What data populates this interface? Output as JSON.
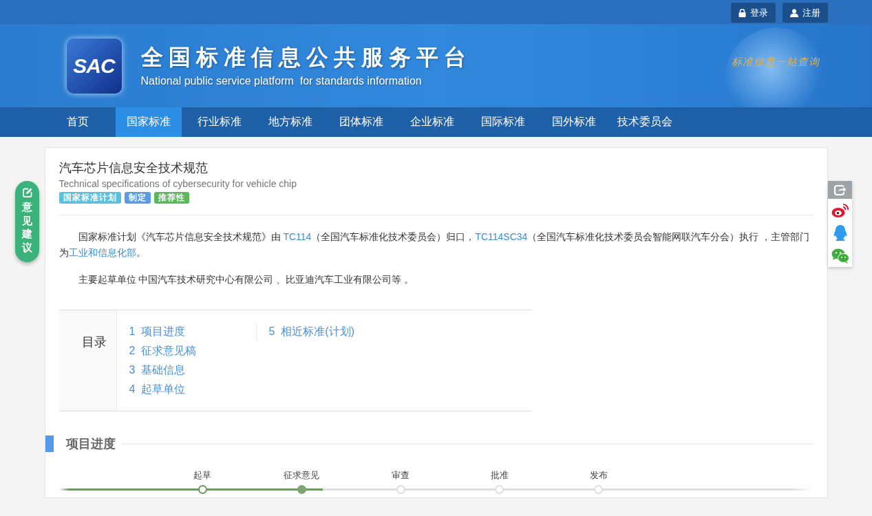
{
  "top_bar": {
    "buttons": [
      {
        "kind": "login",
        "label": "登录"
      },
      {
        "kind": "register",
        "label": "注册"
      }
    ]
  },
  "banner": {
    "logo": "SAC",
    "title": "全国标准信息公共服务平台",
    "subtitle": "National public service platform  for standards information",
    "slogan": "标准信息一站查询"
  },
  "nav": [
    {
      "label": "首页",
      "selected": false
    },
    {
      "label": "国家标准",
      "selected": true
    },
    {
      "label": "行业标准",
      "selected": false
    },
    {
      "label": "地方标准",
      "selected": false
    },
    {
      "label": "团体标准",
      "selected": false
    },
    {
      "label": "企业标准",
      "selected": false
    },
    {
      "label": "国际标准",
      "selected": false
    },
    {
      "label": "国外标准",
      "selected": false
    },
    {
      "label": "技术委员会",
      "selected": false
    }
  ],
  "feedback": {
    "label": "意见建议"
  },
  "share_panel": [
    {
      "kind": "share"
    },
    {
      "kind": "weibo"
    },
    {
      "kind": "qq"
    },
    {
      "kind": "wechat"
    }
  ],
  "standard": {
    "title": "汽车芯片信息安全技术规范",
    "english_title": "Technical specifications of cybersecurity for vehicle chip",
    "tags": [
      {
        "label": "国家标准计划",
        "color": "#5bc0de"
      },
      {
        "label": "制定",
        "color": "#5a9be6"
      },
      {
        "label": "推荐性",
        "color": "#5cb85c"
      }
    ],
    "paragraphs": [
      [
        {
          "kind": "text",
          "text": "国家标准计划《汽车芯片信息安全技术规范》由 "
        },
        {
          "kind": "link",
          "text": "TC114"
        },
        {
          "kind": "text",
          "text": "（全国汽车标准化技术委员会）归口，"
        },
        {
          "kind": "link",
          "text": "TC114SC34"
        },
        {
          "kind": "text",
          "text": "（全国汽车标准化技术委员会智能网联汽车分会）执行 ，主管部门为"
        },
        {
          "kind": "link",
          "text": "工业和信息化部"
        },
        {
          "kind": "text",
          "text": "。"
        }
      ],
      [
        {
          "kind": "text",
          "text": "主要起草单位 中国汽车技术研究中心有限公司 、比亚迪汽车工业有限公司等 。"
        }
      ]
    ]
  },
  "toc": {
    "label": "目录",
    "columns": [
      [
        {
          "number": "1",
          "label": "项目进度"
        },
        {
          "number": "2",
          "label": "征求意见稿"
        },
        {
          "number": "3",
          "label": "基础信息"
        },
        {
          "number": "4",
          "label": "起草单位"
        }
      ],
      [
        {
          "number": "5",
          "label": "相近标准(计划)"
        }
      ]
    ]
  },
  "progress": {
    "heading": "项目进度",
    "level": 0.35,
    "stages": [
      {
        "label": "起草",
        "completed": true,
        "current": false
      },
      {
        "label": "征求意见",
        "completed": true,
        "current": true
      },
      {
        "label": "审查",
        "completed": false,
        "current": false
      },
      {
        "label": "批准",
        "completed": false,
        "current": false
      },
      {
        "label": "发布",
        "completed": false,
        "current": false
      }
    ]
  }
}
